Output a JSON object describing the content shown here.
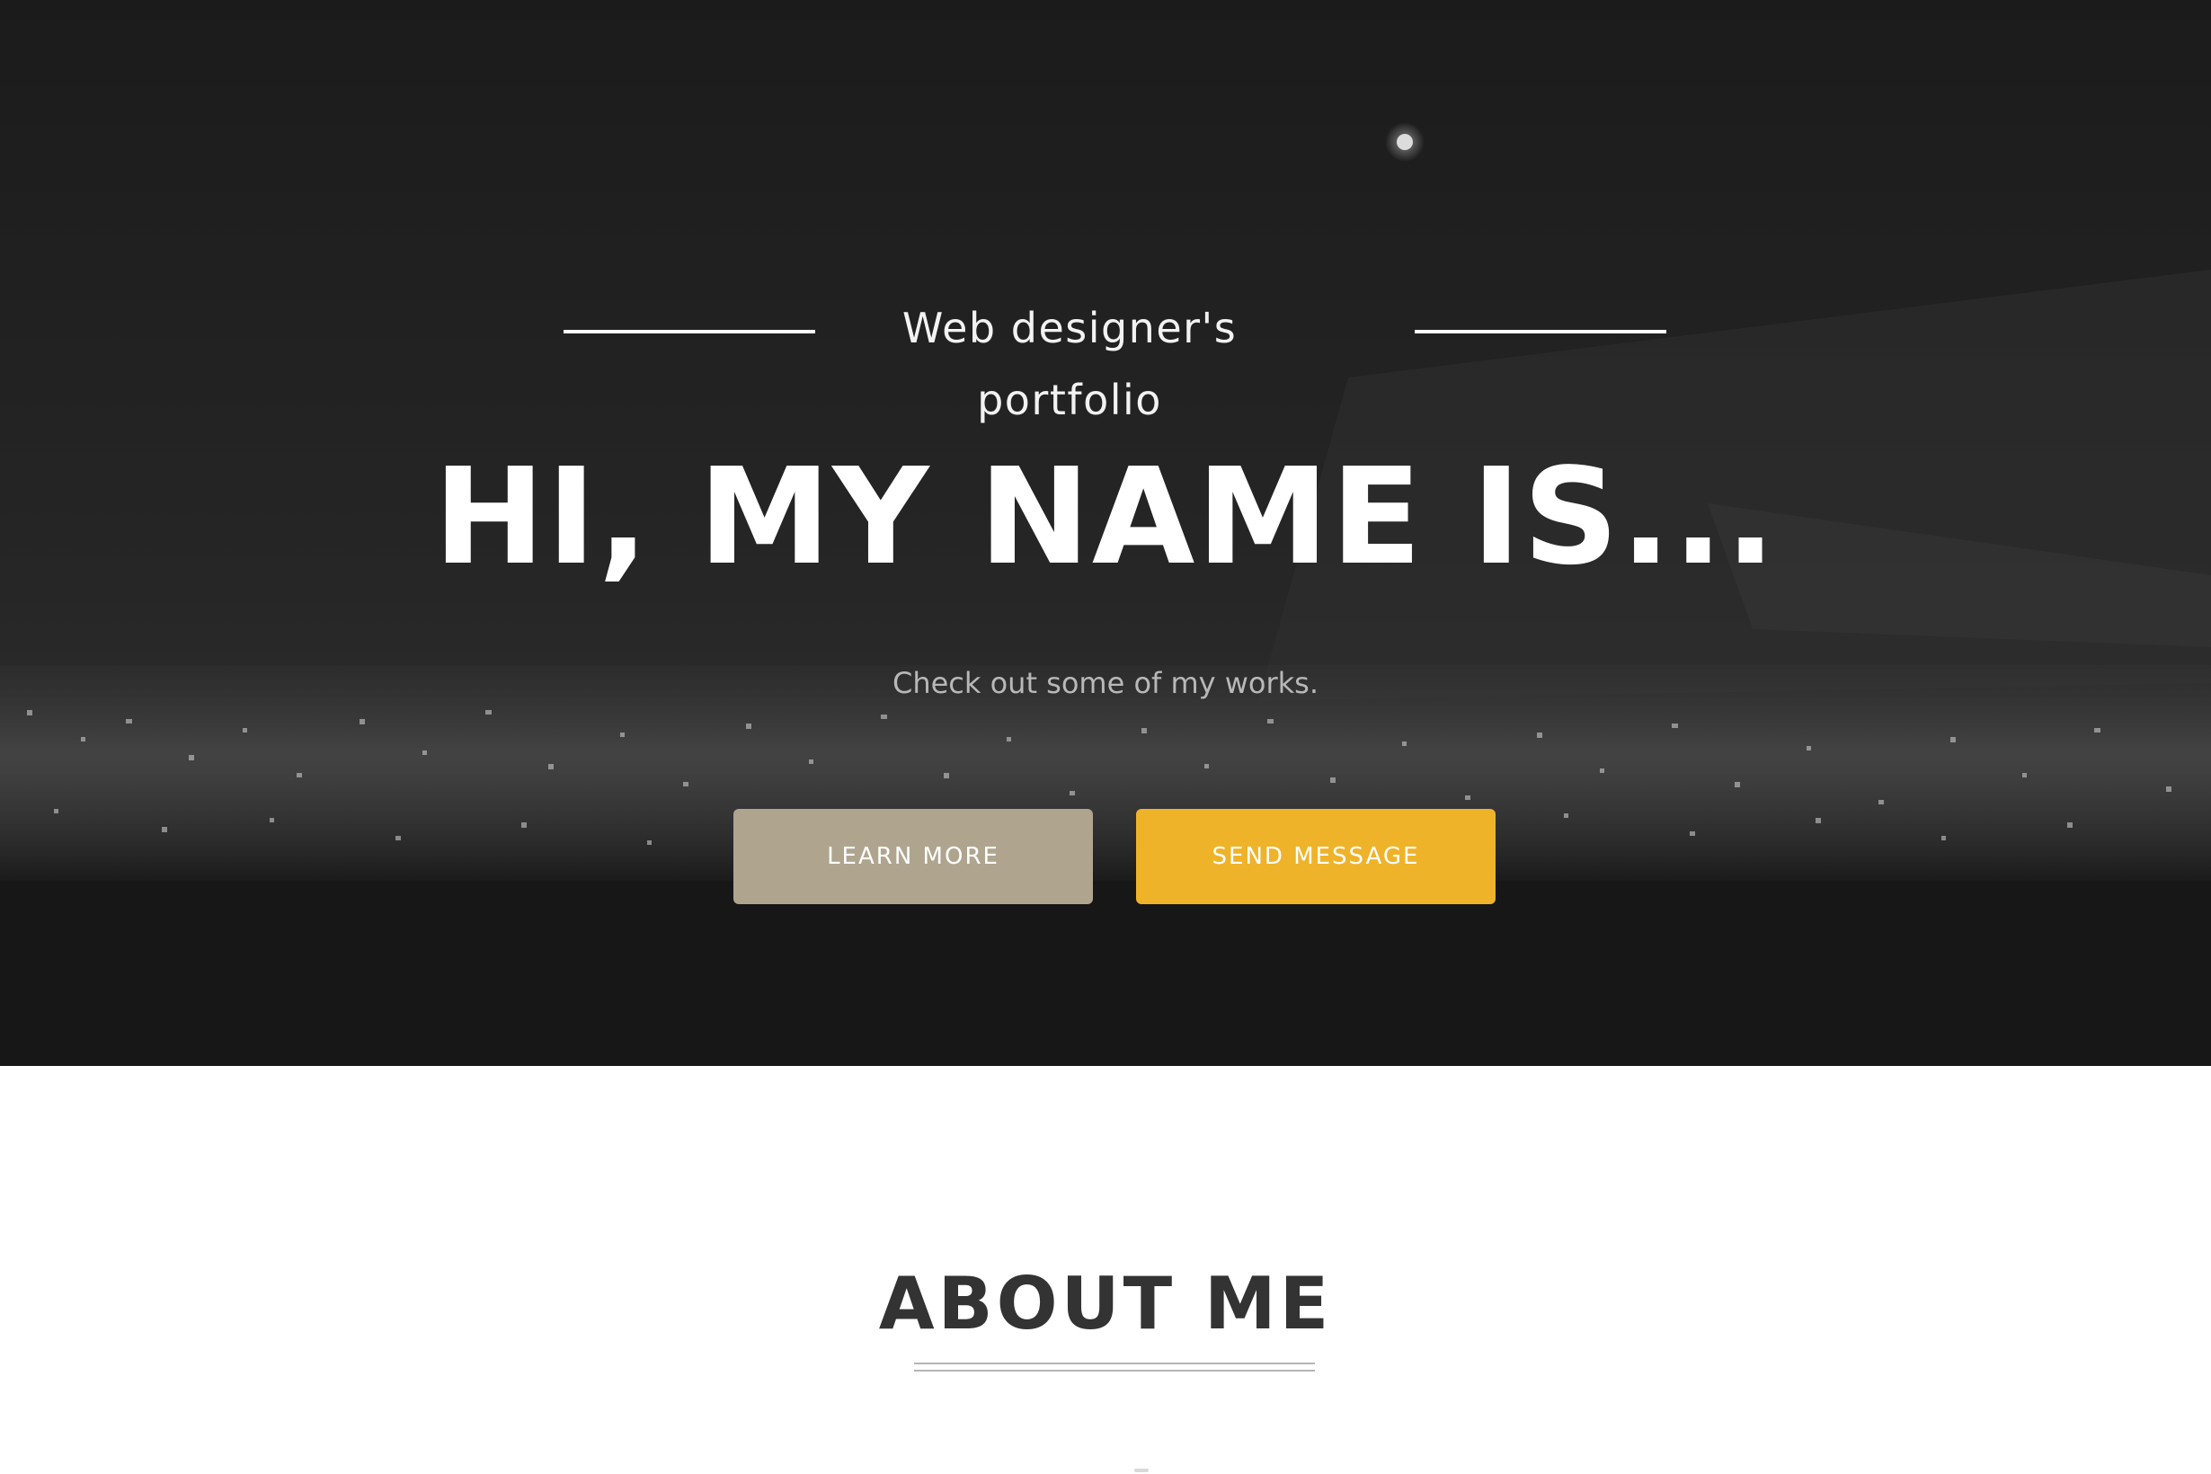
{
  "hero": {
    "tagline": "Web designer's portfolio",
    "headline": "HI, MY NAME IS...",
    "subline": "Check out some of my works.",
    "buttons": {
      "learn_more": "LEARN MORE",
      "send_message": "SEND MESSAGE"
    },
    "background_image": "night-city-skyline-image"
  },
  "about": {
    "title": "ABOUT ME"
  },
  "colors": {
    "hero_background": "#1c1c1c",
    "learn_more_button": "#afa58f",
    "send_message_button": "#efb32a",
    "about_title": "#333333",
    "white": "#ffffff"
  }
}
